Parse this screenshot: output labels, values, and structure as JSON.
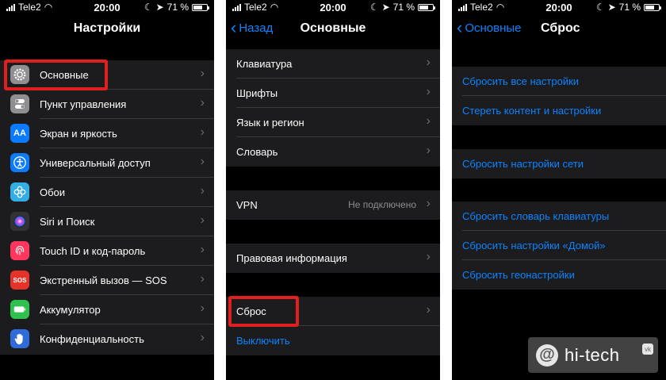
{
  "status": {
    "carrier": "Tele2",
    "time": "20:00",
    "battery": "71 %",
    "battery_level": 0.71
  },
  "screen1": {
    "title": "Настройки",
    "items": [
      {
        "label": "Основные",
        "icon": "gear-icon",
        "color": "#8e8e93"
      },
      {
        "label": "Пункт управления",
        "icon": "toggles-icon",
        "color": "#8e8e93"
      },
      {
        "label": "Экран и яркость",
        "icon": "display-icon",
        "color": "#0a7aff",
        "glyph": "AA"
      },
      {
        "label": "Универсальный доступ",
        "icon": "accessibility-icon",
        "color": "#0a7aff"
      },
      {
        "label": "Обои",
        "icon": "wallpaper-icon",
        "color": "#32ade6"
      },
      {
        "label": "Siri и Поиск",
        "icon": "siri-icon",
        "color": "#333333"
      },
      {
        "label": "Touch ID и код-пароль",
        "icon": "fingerprint-icon",
        "color": "#ff375f"
      },
      {
        "label": "Экстренный вызов — SOS",
        "icon": "sos-icon",
        "color": "#e5332a",
        "glyph": "SOS"
      },
      {
        "label": "Аккумулятор",
        "icon": "battery-icon",
        "color": "#30c04f"
      },
      {
        "label": "Конфиденциальность",
        "icon": "privacy-hand-icon",
        "color": "#2f6bd9"
      }
    ]
  },
  "screen2": {
    "back": "Назад",
    "title": "Основные",
    "group1": [
      "Клавиатура",
      "Шрифты",
      "Язык и регион",
      "Словарь"
    ],
    "vpn": {
      "label": "VPN",
      "value": "Не подключено"
    },
    "legal": "Правовая информация",
    "reset": "Сброс",
    "shutdown": "Выключить"
  },
  "screen3": {
    "back": "Основные",
    "title": "Сброс",
    "group1": [
      "Сбросить все настройки",
      "Стереть контент и настройки"
    ],
    "group2": [
      "Сбросить настройки сети"
    ],
    "group3": [
      "Сбросить словарь клавиатуры",
      "Сбросить настройки «Домой»",
      "Сбросить геонастройки"
    ]
  },
  "watermark": {
    "symbol": "@",
    "text": "hi-tech",
    "badge": "vk"
  }
}
